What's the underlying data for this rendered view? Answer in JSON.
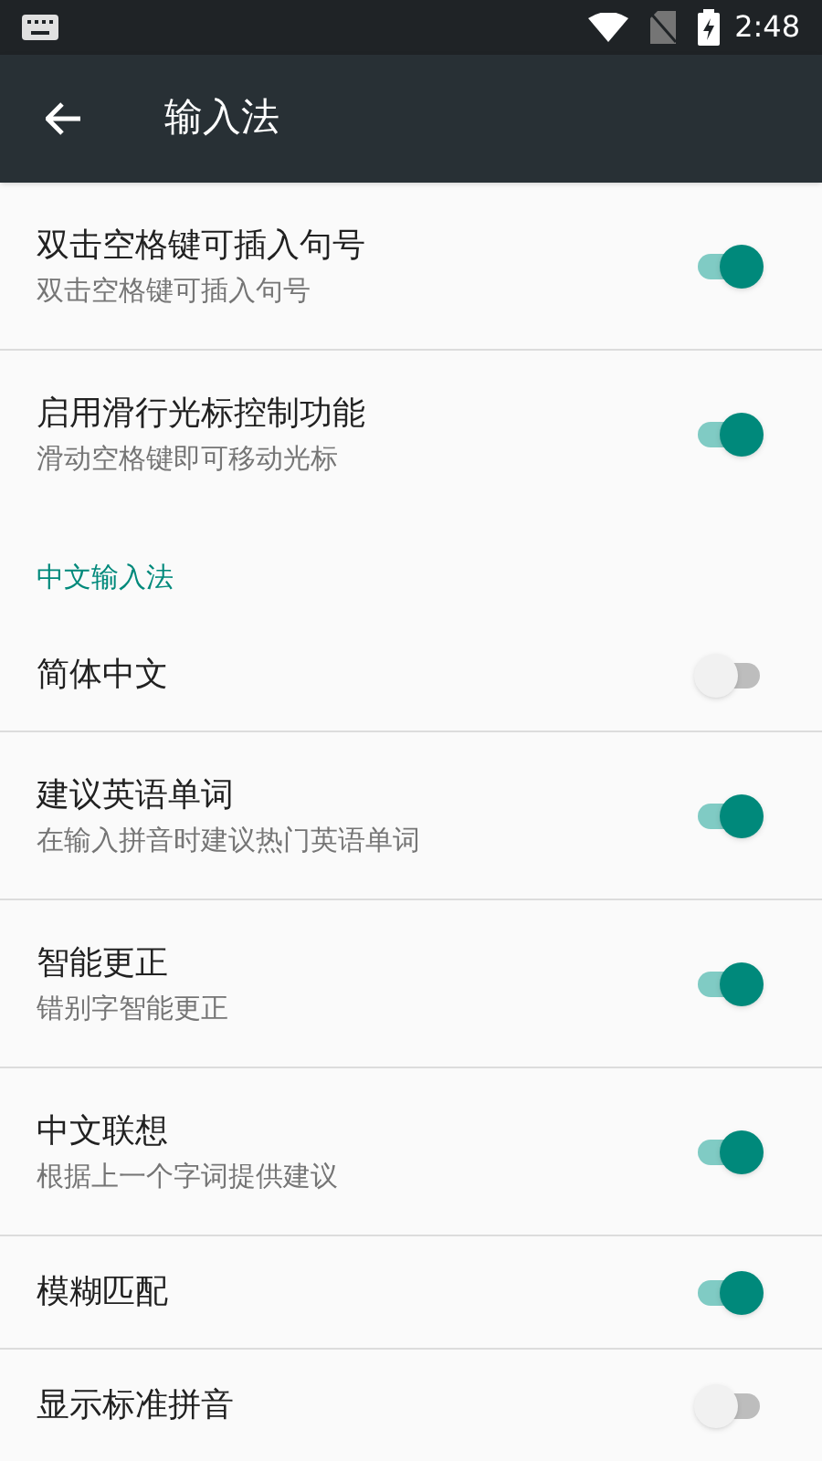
{
  "status_bar": {
    "time": "2:48"
  },
  "toolbar": {
    "title": "输入法"
  },
  "items": [
    {
      "kind": "setting",
      "title": "双击空格键可插入句号",
      "summary": "双击空格键可插入句号",
      "on": true
    },
    {
      "kind": "setting",
      "title": "启用滑行光标控制功能",
      "summary": "滑动空格键即可移动光标",
      "on": true
    },
    {
      "kind": "header",
      "title": "中文输入法"
    },
    {
      "kind": "setting",
      "title": "简体中文",
      "on": false
    },
    {
      "kind": "setting",
      "title": "建议英语单词",
      "summary": "在输入拼音时建议热门英语单词",
      "on": true
    },
    {
      "kind": "setting",
      "title": "智能更正",
      "summary": "错别字智能更正",
      "on": true
    },
    {
      "kind": "setting",
      "title": "中文联想",
      "summary": "根据上一个字词提供建议",
      "on": true
    },
    {
      "kind": "setting",
      "title": "模糊匹配",
      "on": true
    },
    {
      "kind": "setting",
      "title": "显示标准拼音",
      "on": false
    }
  ]
}
